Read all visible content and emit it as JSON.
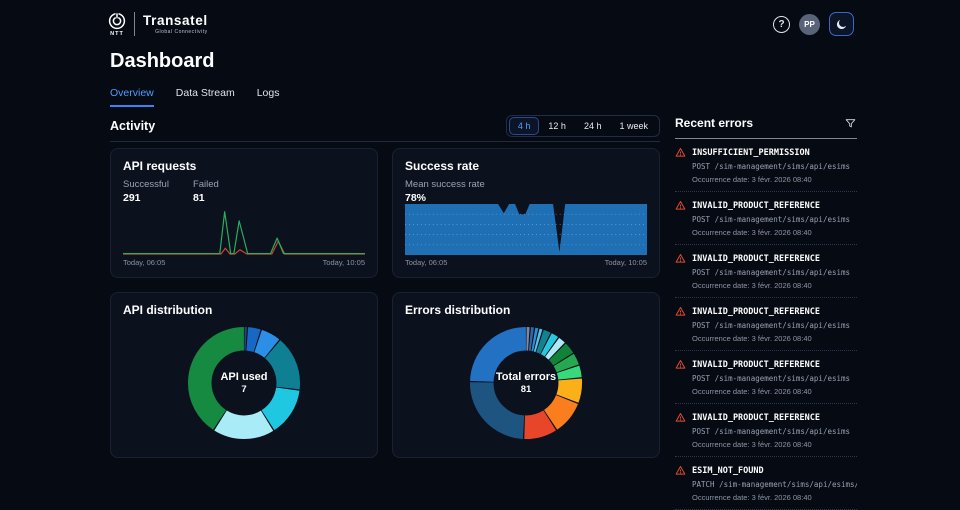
{
  "header": {
    "brand": {
      "ntt": "NTT",
      "name": "Transatel",
      "tagline": "Global Connectivity"
    },
    "help_glyph": "?",
    "avatar": "PP"
  },
  "page_title": "Dashboard",
  "tabs": [
    {
      "label": "Overview",
      "active": true
    },
    {
      "label": "Data Stream",
      "active": false
    },
    {
      "label": "Logs",
      "active": false
    }
  ],
  "activity": {
    "title": "Activity",
    "ranges": [
      {
        "label": "4 h",
        "active": true
      },
      {
        "label": "12 h",
        "active": false
      },
      {
        "label": "24 h",
        "active": false
      },
      {
        "label": "1 week",
        "active": false
      }
    ]
  },
  "cards": {
    "api_requests": {
      "title": "API requests",
      "stats": [
        {
          "label": "Successful",
          "value": "291"
        },
        {
          "label": "Failed",
          "value": "81"
        }
      ]
    },
    "success_rate": {
      "title": "Success rate",
      "stat_label": "Mean success rate",
      "stat_value": "78%"
    },
    "api_distribution": {
      "title": "API distribution"
    },
    "errors_distribution": {
      "title": "Errors distribution"
    }
  },
  "chart_data": [
    {
      "type": "line",
      "title": "API requests",
      "x_axis": [
        "Today, 06:05",
        "Today, 10:05"
      ],
      "ylim": [
        0,
        100
      ],
      "series": [
        {
          "name": "Successful",
          "color": "#27ae60",
          "points": [
            [
              0,
              1
            ],
            [
              0.4,
              1
            ],
            [
              0.42,
              88
            ],
            [
              0.445,
              1
            ],
            [
              0.458,
              1
            ],
            [
              0.48,
              69
            ],
            [
              0.515,
              1
            ],
            [
              0.61,
              1
            ],
            [
              0.637,
              33
            ],
            [
              0.663,
              1
            ],
            [
              1,
              1
            ]
          ]
        },
        {
          "name": "Failed",
          "color": "#cb4631",
          "points": [
            [
              0,
              0
            ],
            [
              0.405,
              0
            ],
            [
              0.423,
              12
            ],
            [
              0.442,
              0
            ],
            [
              0.462,
              0
            ],
            [
              0.483,
              9
            ],
            [
              0.512,
              0
            ],
            [
              0.615,
              0
            ],
            [
              0.642,
              27
            ],
            [
              0.668,
              0
            ],
            [
              1,
              0
            ]
          ]
        }
      ]
    },
    {
      "type": "area",
      "title": "Success rate",
      "x_axis": [
        "Today, 06:05",
        "Today, 10:05"
      ],
      "ylim": [
        0,
        100
      ],
      "gridlines": 4,
      "series": [
        {
          "name": "Success rate",
          "color": "#1e6fb4",
          "points": [
            [
              0,
              100
            ],
            [
              0.385,
              100
            ],
            [
              0.408,
              82
            ],
            [
              0.43,
              100
            ],
            [
              0.455,
              100
            ],
            [
              0.472,
              80
            ],
            [
              0.497,
              80
            ],
            [
              0.515,
              100
            ],
            [
              0.612,
              100
            ],
            [
              0.638,
              6
            ],
            [
              0.662,
              100
            ],
            [
              1,
              100
            ]
          ]
        }
      ]
    },
    {
      "type": "donut",
      "title": "API distribution",
      "center": {
        "label": "API used",
        "value": "7"
      },
      "segments": [
        {
          "value": 1,
          "color": "#25486f"
        },
        {
          "value": 4,
          "color": "#1668c4"
        },
        {
          "value": 6,
          "color": "#2b8fe8"
        },
        {
          "value": 16,
          "color": "#0f7f93"
        },
        {
          "value": 14,
          "color": "#1fc8e0"
        },
        {
          "value": 18,
          "color": "#aaebf8"
        },
        {
          "value": 41,
          "color": "#168a40"
        }
      ]
    },
    {
      "type": "donut",
      "title": "Errors distribution",
      "center": {
        "label": "Total errors",
        "value": "81"
      },
      "segments": [
        {
          "value": 1,
          "color": "#7c8aa0"
        },
        {
          "value": 1,
          "color": "#3465a8"
        },
        {
          "value": 1,
          "color": "#2b8fd4"
        },
        {
          "value": 1,
          "color": "#55c1ea"
        },
        {
          "value": 2,
          "color": "#128291"
        },
        {
          "value": 2,
          "color": "#27c8de"
        },
        {
          "value": 2,
          "color": "#aeeaf6"
        },
        {
          "value": 3,
          "color": "#108339"
        },
        {
          "value": 3,
          "color": "#27a74f"
        },
        {
          "value": 3,
          "color": "#38d97c"
        },
        {
          "value": 6,
          "color": "#fbaf18"
        },
        {
          "value": 8,
          "color": "#fa7d1e"
        },
        {
          "value": 8,
          "color": "#e8462a"
        },
        {
          "value": 20,
          "color": "#1d5480"
        },
        {
          "value": 20,
          "color": "#2271c2"
        }
      ]
    }
  ],
  "recent_errors": {
    "title": "Recent errors",
    "items": [
      {
        "code": "INSUFFICIENT_PERMISSION",
        "request": "POST /sim-management/sims/api/esims",
        "date": "Occurrence date: 3 févr. 2026 08:40"
      },
      {
        "code": "INVALID_PRODUCT_REFERENCE",
        "request": "POST /sim-management/sims/api/esims",
        "date": "Occurrence date: 3 févr. 2026 08:40"
      },
      {
        "code": "INVALID_PRODUCT_REFERENCE",
        "request": "POST /sim-management/sims/api/esims",
        "date": "Occurrence date: 3 févr. 2026 08:40"
      },
      {
        "code": "INVALID_PRODUCT_REFERENCE",
        "request": "POST /sim-management/sims/api/esims",
        "date": "Occurrence date: 3 févr. 2026 08:40"
      },
      {
        "code": "INVALID_PRODUCT_REFERENCE",
        "request": "POST /sim-management/sims/api/esims",
        "date": "Occurrence date: 3 févr. 2026 08:40"
      },
      {
        "code": "INVALID_PRODUCT_REFERENCE",
        "request": "POST /sim-management/sims/api/esims",
        "date": "Occurrence date: 3 févr. 2026 08:40"
      },
      {
        "code": "ESIM_NOT_FOUND",
        "request": "PATCH /sim-management/sims/api/esims/si…",
        "date": "Occurrence date: 3 févr. 2026 08:40"
      }
    ]
  },
  "colors": {
    "accent": "#4d9fff",
    "success": "#27ae60",
    "failed": "#cb4631",
    "warning": "#e1492f",
    "area_fill": "#1e6fb4"
  }
}
